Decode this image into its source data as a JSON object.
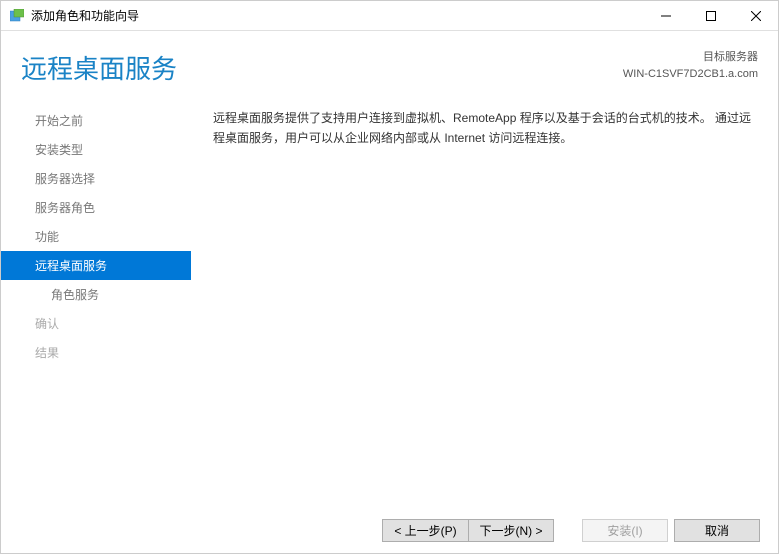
{
  "window": {
    "title": "添加角色和功能向导"
  },
  "header": {
    "page_title": "远程桌面服务",
    "server_label": "目标服务器",
    "server_name": "WIN-C1SVF7D2CB1.a.com"
  },
  "sidebar": {
    "items": [
      {
        "label": "开始之前",
        "state": "clickable"
      },
      {
        "label": "安装类型",
        "state": "clickable"
      },
      {
        "label": "服务器选择",
        "state": "clickable"
      },
      {
        "label": "服务器角色",
        "state": "clickable"
      },
      {
        "label": "功能",
        "state": "clickable"
      },
      {
        "label": "远程桌面服务",
        "state": "active"
      },
      {
        "label": "角色服务",
        "state": "sub"
      },
      {
        "label": "确认",
        "state": "disabled"
      },
      {
        "label": "结果",
        "state": "disabled"
      }
    ]
  },
  "content": {
    "description": "远程桌面服务提供了支持用户连接到虚拟机、RemoteApp 程序以及基于会话的台式机的技术。 通过远程桌面服务，用户可以从企业网络内部或从 Internet 访问远程连接。"
  },
  "footer": {
    "prev": "< 上一步(P)",
    "next": "下一步(N) >",
    "install": "安装(I)",
    "cancel": "取消"
  }
}
